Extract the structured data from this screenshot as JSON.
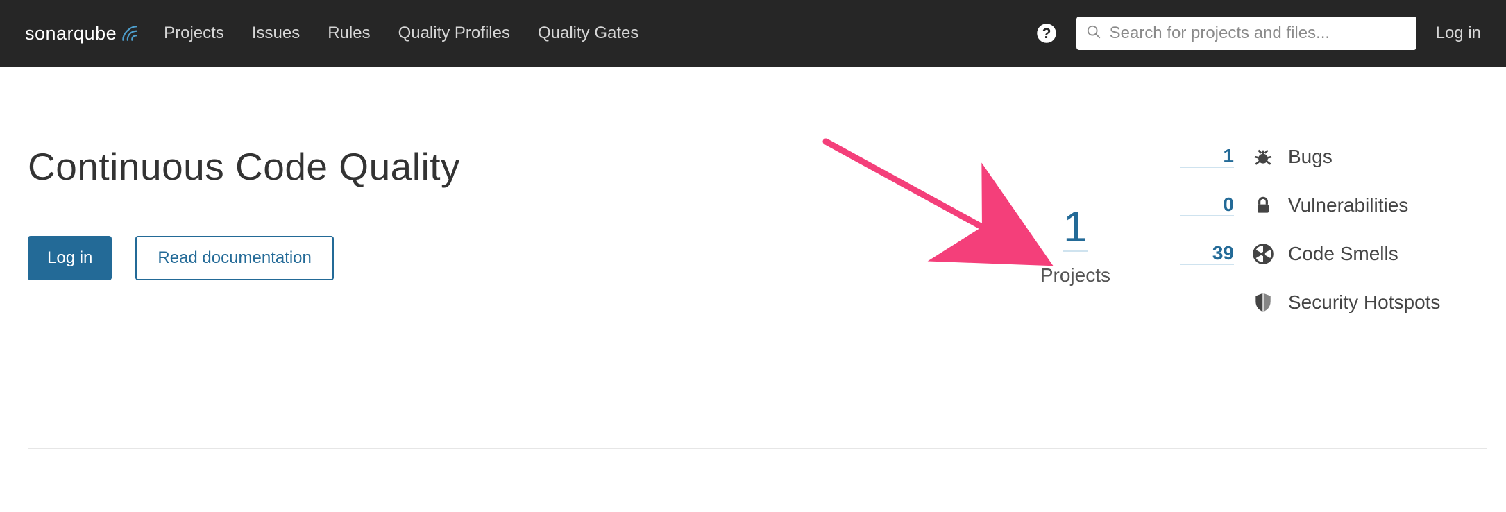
{
  "header": {
    "logo_left": "sonar",
    "logo_right": "qube",
    "nav": [
      "Projects",
      "Issues",
      "Rules",
      "Quality Profiles",
      "Quality Gates"
    ],
    "search_placeholder": "Search for projects and files...",
    "login": "Log in"
  },
  "main": {
    "title": "Continuous Code Quality",
    "login_button": "Log in",
    "docs_button": "Read documentation"
  },
  "stats": {
    "projects_count": "1",
    "projects_label": "Projects",
    "metrics": [
      {
        "count": "1",
        "label": "Bugs"
      },
      {
        "count": "0",
        "label": "Vulnerabilities"
      },
      {
        "count": "39",
        "label": "Code Smells"
      },
      {
        "count": "",
        "label": "Security Hotspots"
      }
    ]
  },
  "colors": {
    "accent": "#236a97",
    "arrow": "#f43f7a"
  }
}
